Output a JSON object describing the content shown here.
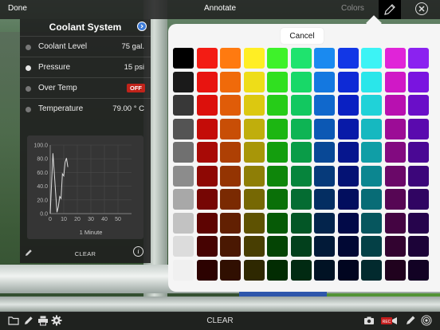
{
  "topbar": {
    "done_label": "Done",
    "title": "Annotate",
    "colors_label": "Colors",
    "pen_icon": "pen-icon",
    "close_icon": "close-icon"
  },
  "panel": {
    "title": "Coolant System",
    "info_icon": "info-icon",
    "rows": [
      {
        "label": "Coolant Level",
        "value": "75 gal.",
        "dot": "off"
      },
      {
        "label": "Pressure",
        "value": "15 psi",
        "dot": "on"
      },
      {
        "label": "Over Temp",
        "badge": "OFF",
        "dot": "off"
      },
      {
        "label": "Temperature",
        "value": "79.00 ° C",
        "dot": "off"
      }
    ],
    "chart_xlabel": "1 Minute",
    "clear_label": "CLEAR"
  },
  "chart_data": {
    "type": "line",
    "xlabel": "1 Minute",
    "xlim": [
      0,
      60
    ],
    "ylim": [
      0,
      100
    ],
    "x_ticks": [
      0,
      10,
      20,
      30,
      40,
      50
    ],
    "y_ticks": [
      "0.0",
      "20.0",
      "40.0",
      "60.0",
      "80.0",
      "100.0"
    ],
    "series": [
      {
        "x": [
          0,
          2,
          3,
          4,
          5,
          6,
          7,
          8,
          9,
          10,
          11,
          12,
          13
        ],
        "y": [
          0,
          88,
          60,
          30,
          2,
          10,
          25,
          22,
          58,
          55,
          75,
          81,
          68
        ]
      }
    ]
  },
  "popover": {
    "cancel_label": "Cancel",
    "colors": [
      [
        "#000000",
        "#f31c14",
        "#ff7a10",
        "#ffee24",
        "#3ef22a",
        "#1fe36e",
        "#1a8af0",
        "#1237e6",
        "#3cf3f5",
        "#e024d8",
        "#8b22f0"
      ],
      [
        "#1a1a1a",
        "#e81410",
        "#f06a0a",
        "#eedd18",
        "#30e020",
        "#18d868",
        "#1478e0",
        "#0e2ad6",
        "#2ae6ea",
        "#d018c6",
        "#7a14e0"
      ],
      [
        "#383838",
        "#dc100c",
        "#e05c08",
        "#dcc810",
        "#26cc18",
        "#12c860",
        "#1068cc",
        "#0a20c2",
        "#20d2d8",
        "#b810b0",
        "#6a0ec8"
      ],
      [
        "#545454",
        "#c40c08",
        "#c84e06",
        "#c0ae0c",
        "#1cb612",
        "#0eb454",
        "#0c58b4",
        "#081aa8",
        "#16b8c0",
        "#9c0c96",
        "#5a0aae"
      ],
      [
        "#707070",
        "#a80a06",
        "#ae4004",
        "#a89608",
        "#149e0e",
        "#0a9c48",
        "#084896",
        "#06168e",
        "#109ea6",
        "#820a80",
        "#4a0894"
      ],
      [
        "#8c8c8c",
        "#8e0804",
        "#943402",
        "#8e7e06",
        "#0e860a",
        "#06843c",
        "#063a7a",
        "#041274",
        "#0c8690",
        "#6a0868",
        "#3c067a"
      ],
      [
        "#a8a8a8",
        "#760604",
        "#7a2a02",
        "#766804",
        "#0a7008",
        "#046c32",
        "#042e62",
        "#020e5e",
        "#086c76",
        "#560654",
        "#300562"
      ],
      [
        "#c2c2c2",
        "#5e0402",
        "#622002",
        "#5e5202",
        "#065a06",
        "#035626",
        "#03244c",
        "#020a48",
        "#06565e",
        "#440442",
        "#26044c"
      ],
      [
        "#dcdcdc",
        "#460302",
        "#4a1802",
        "#483e02",
        "#044404",
        "#02401c",
        "#021a38",
        "#010834",
        "#044046",
        "#320330",
        "#1c0338"
      ],
      [
        "#f0f0f0",
        "#2c0201",
        "#300f01",
        "#2e2801",
        "#022c02",
        "#012a12",
        "#011224",
        "#010520",
        "#022a2e",
        "#20021e",
        "#120224"
      ]
    ]
  },
  "bottombar": {
    "clear_label": "CLEAR",
    "icons": [
      "folder-icon",
      "pencil-icon",
      "printer-icon",
      "gear-icon",
      "camera-icon",
      "record-icon",
      "pen-icon",
      "target-icon"
    ]
  }
}
